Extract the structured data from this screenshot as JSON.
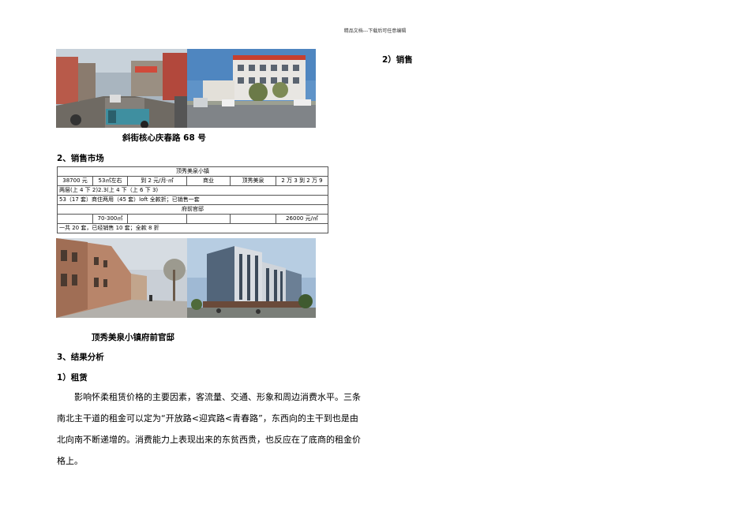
{
  "header_note": "精品文档---下载后可任意编辑",
  "right_heading": "2）销售",
  "photos": {
    "street1": "street-photo",
    "street2": "building-photo",
    "town": "town-street-photo",
    "apartments": "apartment-render-photo"
  },
  "caption1": "斜街核心庆春路 68 号",
  "section2_heading": "2、销售市场",
  "table": {
    "rows": [
      [
        "顶秀美泉小镇"
      ],
      [
        "38700 元",
        "53㎡左右",
        "到 2 元/月·㎡",
        "商业",
        "顶秀美泉",
        "2 万 3 到 2 万 9"
      ],
      [
        "两层(上 4 下 2)2.3(上 4 下（上 6 下 3)"
      ],
      [
        "53（17 套）商住两用（45 套）loft 全款折；已销售一套"
      ],
      [
        "府前官邸"
      ],
      [
        "",
        "70-300㎡",
        "",
        "",
        "",
        "26000 元/㎡"
      ],
      [
        "一共 20 套，已经销售 10 套；全款 8 折"
      ]
    ]
  },
  "caption2": "顶秀美泉小镇府前官邸",
  "section3_heading": "3、结果分析",
  "sub1_heading": "1）租赁",
  "paragraph": {
    "line1": "影响怀柔租赁价格的主要因素，客流量、交通、形象和周边消费水平。三条",
    "line2": "南北主干道的租金可以定为“开放路<迎宾路<青春路”，东西向的主干到也是由",
    "line3": "北向南不断递增的。消费能力上表现出来的东贫西贵，也反应在了底商的租金价",
    "line4": "格上。"
  }
}
